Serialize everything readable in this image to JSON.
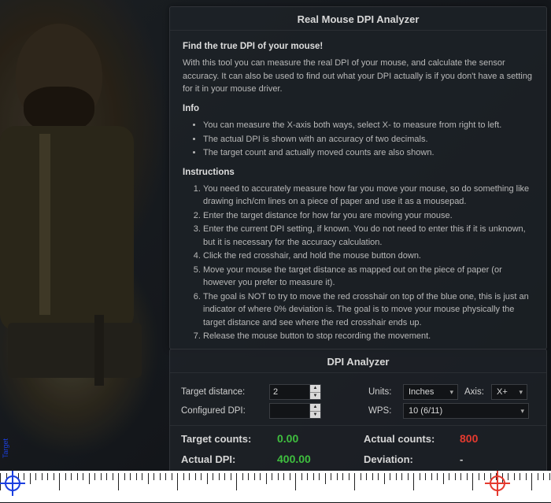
{
  "panel": {
    "title": "Real Mouse DPI Analyzer",
    "find_heading": "Find the true DPI of your mouse!",
    "find_para": "With this tool you can measure the real DPI of your mouse, and calculate the sensor accuracy. It can also be used to find out what your DPI actually is if you don't have a setting for it in your mouse driver.",
    "info_heading": "Info",
    "info_items": [
      "You can measure the X-axis both ways, select X- to measure from right to left.",
      "The actual DPI is shown with an accuracy of two decimals.",
      "The target count and actually moved counts are also shown."
    ],
    "instr_heading": "Instructions",
    "instr_items": [
      "You need to accurately measure how far you move your mouse, so do something like drawing inch/cm lines on a piece of paper and use it as a mousepad.",
      "Enter the target distance for how far you are moving your mouse.",
      "Enter the current DPI setting, if known. You do not need to enter this if it is unknown, but it is necessary for the accuracy calculation.",
      "Click the red crosshair, and hold the mouse button down.",
      "Move your mouse the target distance as mapped out on the piece of paper (or however you prefer to measure it).",
      "The goal is NOT to try to move the red crosshair on top of the blue one, this is just an indicator of where 0% deviation is. The goal is to move your mouse physically the target distance and see where the red crosshair ends up.",
      "Release the mouse button to stop recording the movement."
    ]
  },
  "analyzer": {
    "title": "DPI Analyzer",
    "labels": {
      "target_distance": "Target distance:",
      "units": "Units:",
      "axis": "Axis:",
      "configured_dpi": "Configured DPI:",
      "wps": "WPS:",
      "target_counts": "Target counts:",
      "actual_counts": "Actual counts:",
      "actual_dpi": "Actual DPI:",
      "deviation": "Deviation:"
    },
    "values": {
      "target_distance": "2",
      "configured_dpi": "",
      "units": "Inches",
      "axis": "X+",
      "wps": "10 (6/11)",
      "target_counts": "0.00",
      "actual_counts": "800",
      "actual_dpi": "400.00",
      "deviation": "-"
    }
  },
  "ruler": {
    "target_label": "Target"
  },
  "colors": {
    "green": "#3fbf3f",
    "red": "#e53a2f",
    "blue": "#1b3fe0"
  }
}
